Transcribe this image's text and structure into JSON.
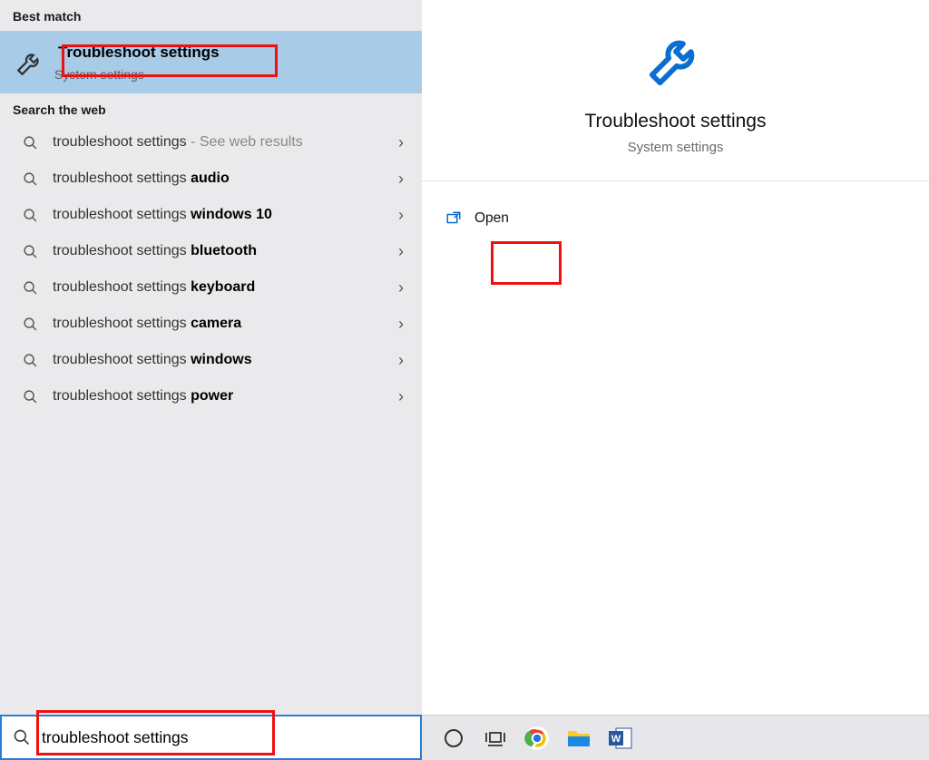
{
  "sections": {
    "best": "Best match",
    "web": "Search the web"
  },
  "bestMatch": {
    "title": "Troubleshoot settings",
    "subtitle": "System settings"
  },
  "suggestions": [
    {
      "prefix": "troubleshoot settings",
      "bold": "",
      "dim": " - See web results"
    },
    {
      "prefix": "troubleshoot settings ",
      "bold": "audio",
      "dim": ""
    },
    {
      "prefix": "troubleshoot settings ",
      "bold": "windows 10",
      "dim": ""
    },
    {
      "prefix": "troubleshoot settings ",
      "bold": "bluetooth",
      "dim": ""
    },
    {
      "prefix": "troubleshoot settings ",
      "bold": "keyboard",
      "dim": ""
    },
    {
      "prefix": "troubleshoot settings ",
      "bold": "camera",
      "dim": ""
    },
    {
      "prefix": "troubleshoot settings ",
      "bold": "windows",
      "dim": ""
    },
    {
      "prefix": "troubleshoot settings ",
      "bold": "power",
      "dim": ""
    }
  ],
  "detail": {
    "title": "Troubleshoot settings",
    "subtitle": "System settings",
    "action": "Open"
  },
  "search": {
    "value": "troubleshoot settings"
  },
  "icons": {
    "wrench": "wrench-icon",
    "search": "search-icon",
    "chevron": "chevron-right-icon",
    "open": "open-icon",
    "cortana": "cortana-icon",
    "taskview": "task-view-icon",
    "chrome": "chrome-icon",
    "explorer": "file-explorer-icon",
    "word": "word-icon"
  }
}
